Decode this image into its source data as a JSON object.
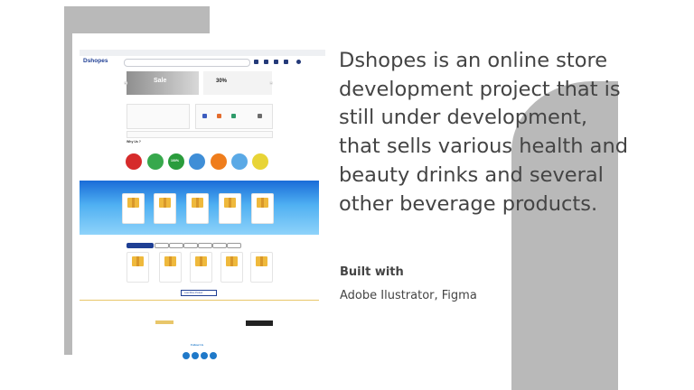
{
  "description": "Dshopes is an online store development project that is still under development, that sells various health and beauty drinks and several other beverage products.",
  "built_with_heading": "Built with",
  "built_with_tools": "Adobe Ilustrator, Figma",
  "mockup": {
    "logo": "Dshopes",
    "banner_sale": "Sale",
    "banner_percent": "30%",
    "why_title": "Why Us ?",
    "categories_100": "100%",
    "load_more": "Load More Product",
    "follow_us": "Follow Us",
    "colors": {
      "brand": "#1f3f94",
      "promo_band": "#3a97e8",
      "accent_gold": "#e8c66a"
    }
  }
}
